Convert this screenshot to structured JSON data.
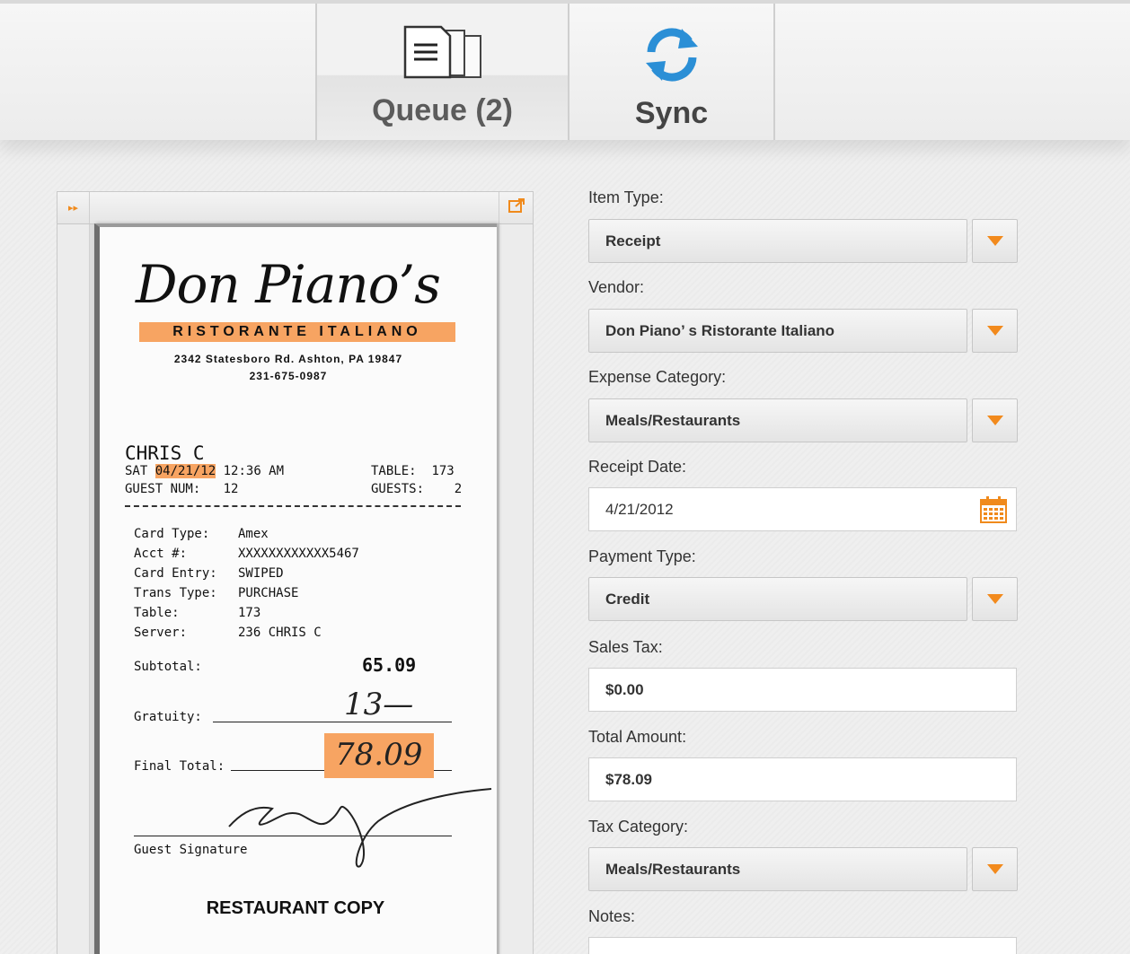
{
  "toolbar": {
    "queue_label": "Queue (2)",
    "sync_label": "Sync",
    "queue_icon": "documents-icon",
    "sync_icon": "sync-icon",
    "accent": "#2b8fd6"
  },
  "receipt": {
    "restaurant_name": "Don Piano’s",
    "subtitle": "RISTORANTE ITALIANO",
    "address": "2342 Statesboro Rd. Ashton, PA 19847",
    "phone": "231-675-0987",
    "server_name": "CHRIS C",
    "day": "SAT",
    "date": "04/21/12",
    "time": "12:36 AM",
    "table_label": "TABLE:",
    "table_value": "173",
    "guest_num_label": "GUEST NUM:",
    "guest_num_value": "12",
    "guests_label": "GUESTS:",
    "guests_value": "2",
    "rows": [
      {
        "label": "Card Type:",
        "value": "Amex"
      },
      {
        "label": "Acct #:",
        "value": "XXXXXXXXXXXX5467"
      },
      {
        "label": "Card Entry:",
        "value": "SWIPED"
      },
      {
        "label": "Trans Type:",
        "value": "PURCHASE"
      },
      {
        "label": "Table:",
        "value": "173"
      },
      {
        "label": "Server:",
        "value": "236 CHRIS C"
      }
    ],
    "subtotal_label": "Subtotal:",
    "subtotal_value": "65.09",
    "gratuity_label": "Gratuity:",
    "gratuity_value": "13—",
    "final_total_label": "Final Total:",
    "final_total_value": "78.09",
    "signature_label": "Guest Signature",
    "copy_label": "RESTAURANT COPY",
    "highlight_color": "#f7a462"
  },
  "form": {
    "item_type": {
      "label": "Item Type:",
      "value": "Receipt"
    },
    "vendor": {
      "label": "Vendor:",
      "value": "Don Piano’ s Ristorante Italiano"
    },
    "expense_category": {
      "label": "Expense Category:",
      "value": "Meals/Restaurants"
    },
    "receipt_date": {
      "label": "Receipt Date:",
      "value": "4/21/2012"
    },
    "payment_type": {
      "label": "Payment Type:",
      "value": "Credit"
    },
    "sales_tax": {
      "label": "Sales Tax:",
      "value": "$0.00"
    },
    "total_amount": {
      "label": "Total Amount:",
      "value": "$78.09"
    },
    "tax_category": {
      "label": "Tax Category:",
      "value": "Meals/Restaurants"
    },
    "notes": {
      "label": "Notes:",
      "value": ""
    },
    "dropdown_accent": "#f28a1d"
  }
}
